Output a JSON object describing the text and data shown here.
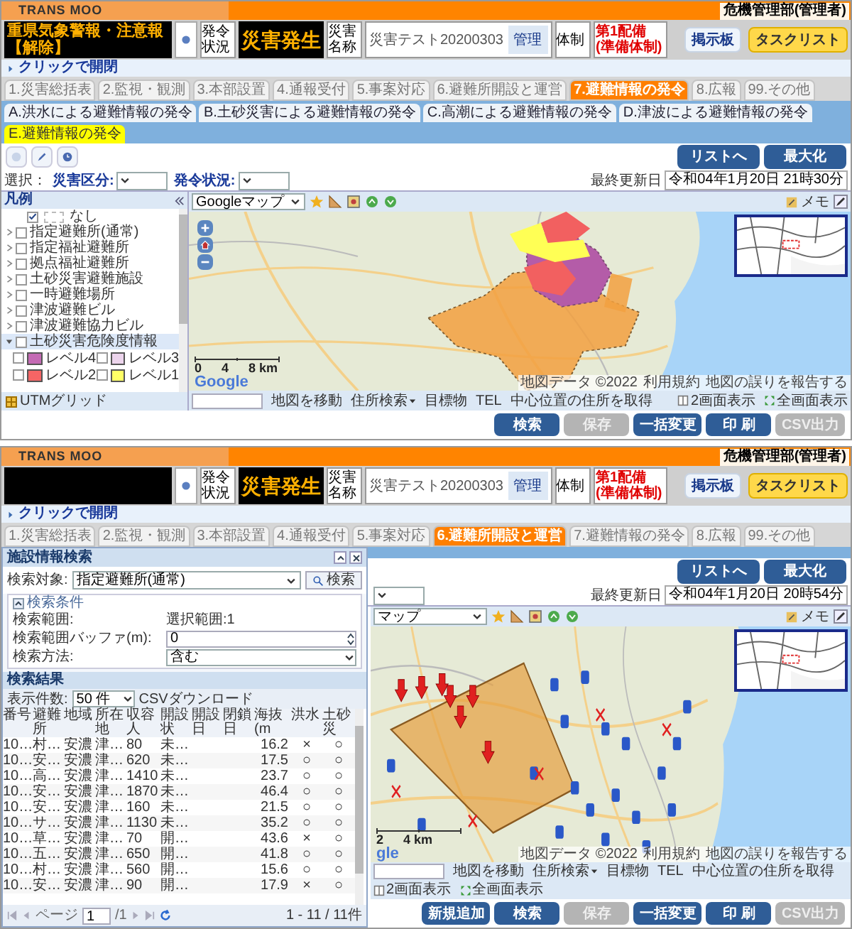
{
  "screens": [
    {
      "brand": "TRANS MOO",
      "user": "危機管理部(管理者)",
      "alert": {
        "title": "重県気象警報・注意報",
        "suffix": "【解除】"
      },
      "status_label": "発令状況",
      "status": "災害発生",
      "disaster_label": "災害名称",
      "disaster_name": "災害テスト20200303",
      "manage_button": "管理",
      "system_label": "体制",
      "system": "第1配備(準備体制)",
      "header_buttons": [
        "掲示板",
        "タスクリスト"
      ],
      "toggle": "クリックで開閉",
      "tabs": [
        {
          "label": "1.災害総括表",
          "selected": false
        },
        {
          "label": "2.監視・観測",
          "selected": false
        },
        {
          "label": "3.本部設置",
          "selected": false
        },
        {
          "label": "4.通報受付",
          "selected": false
        },
        {
          "label": "5.事案対応",
          "selected": false
        },
        {
          "label": "6.避難所開設と運営",
          "selected": false
        },
        {
          "label": "7.避難情報の発令",
          "selected": true
        },
        {
          "label": "8.広報",
          "selected": false
        },
        {
          "label": "99.その他",
          "selected": false
        }
      ],
      "subtabs": [
        {
          "label": "A.洪水による避難情報の発令",
          "selected": false
        },
        {
          "label": "B.土砂災害による避難情報の発令",
          "selected": false
        },
        {
          "label": "C.高潮による避難情報の発令",
          "selected": false
        },
        {
          "label": "D.津波による避難情報の発令",
          "selected": false
        },
        {
          "label": "E.避難情報の発令",
          "selected": true
        }
      ],
      "toolbar_buttons": [
        "リストへ",
        "最大化"
      ],
      "filter_label": "選択：",
      "filters": [
        {
          "label": "災害区分:",
          "kind": "dropdown"
        },
        {
          "label": "発令状況:",
          "kind": "dropdown"
        }
      ],
      "updated_label": "最終更新日",
      "updated": "令和04年1月20日 21時30分",
      "map_type": "Googleマップ",
      "memo": "メモ",
      "legend": {
        "title": "凡例",
        "footer": "UTMグリッド",
        "items": [
          {
            "kind": "none",
            "label": "なし",
            "checked": true,
            "selected": false
          },
          {
            "kind": "layer",
            "label": "指定避難所(通常)",
            "checked": false,
            "expanded": false,
            "selected": false
          },
          {
            "kind": "layer",
            "label": "指定福祉避難所",
            "checked": false,
            "expanded": false,
            "selected": false
          },
          {
            "kind": "layer",
            "label": "拠点福祉避難所",
            "checked": false,
            "expanded": false,
            "selected": false
          },
          {
            "kind": "layer",
            "label": "土砂災害避難施設",
            "checked": false,
            "expanded": false,
            "selected": false
          },
          {
            "kind": "layer",
            "label": "一時避難場所",
            "checked": false,
            "expanded": false,
            "selected": false
          },
          {
            "kind": "layer",
            "label": "津波避難ビル",
            "checked": false,
            "expanded": false,
            "selected": false
          },
          {
            "kind": "layer",
            "label": "津波避難協力ビル",
            "checked": false,
            "expanded": false,
            "selected": false
          },
          {
            "kind": "layer",
            "label": "土砂災害危険度情報",
            "checked": false,
            "expanded": true,
            "selected": true,
            "children": [
              {
                "label": "レベル4",
                "checked": false,
                "color": "#c46ab4"
              },
              {
                "label": "レベル3",
                "checked": false,
                "color": "#ecd4ec"
              },
              {
                "label": "レベル2",
                "checked": false,
                "color": "#f66565"
              },
              {
                "label": "レベル1",
                "checked": false,
                "color": "#ffff66"
              }
            ]
          }
        ]
      },
      "map": {
        "kind": "hazard",
        "logo": "Google",
        "scale": [
          "0",
          "4",
          "8 km"
        ],
        "attribution": [
          "地図データ ©2022",
          "利用規約",
          "地図の誤りを報告する"
        ]
      },
      "map_footer": [
        {
          "label": "地図を移動",
          "kind": "link"
        },
        {
          "label": "住所検索",
          "kind": "menu"
        },
        {
          "label": "目標物",
          "kind": "link"
        },
        {
          "label": "TEL",
          "kind": "link"
        },
        {
          "label": "中心位置の住所を取得",
          "kind": "link"
        }
      ],
      "view_buttons": [
        {
          "label": "2画面表示",
          "kind": "split"
        },
        {
          "label": "全画面表示",
          "kind": "full"
        }
      ],
      "action_buttons": [
        {
          "label": "検索",
          "disabled": false
        },
        {
          "label": "保存",
          "disabled": true
        },
        {
          "label": "一括変更",
          "disabled": false
        },
        {
          "label": "印 刷",
          "disabled": false
        },
        {
          "label": "CSV出力",
          "disabled": true
        }
      ]
    },
    {
      "brand": "TRANS MOO",
      "user": "危機管理部(管理者)",
      "status_label": "発令状況",
      "status": "災害発生",
      "disaster_label": "災害名称",
      "disaster_name": "災害テスト20200303",
      "manage_button": "管理",
      "system_label": "体制",
      "system": "第1配備(準備体制)",
      "header_buttons": [
        "掲示板",
        "タスクリスト"
      ],
      "toggle": "クリックで開閉",
      "tabs": [
        {
          "label": "1.災害総括表",
          "selected": false
        },
        {
          "label": "2.監視・観測",
          "selected": false
        },
        {
          "label": "3.本部設置",
          "selected": false
        },
        {
          "label": "4.通報受付",
          "selected": false
        },
        {
          "label": "5.事案対応",
          "selected": false
        },
        {
          "label": "6.避難所開設と運営",
          "selected": true
        },
        {
          "label": "7.避難情報の発令",
          "selected": false
        },
        {
          "label": "8.広報",
          "selected": false
        },
        {
          "label": "99.その他",
          "selected": false
        }
      ],
      "toolbar_buttons": [
        "リストへ",
        "最大化"
      ],
      "filters": [
        {
          "kind": "dropdown"
        }
      ],
      "updated_label": "最終更新日",
      "updated": "令和04年1月20日 20時54分",
      "map_type": "マップ",
      "memo": "メモ",
      "map": {
        "kind": "shelters",
        "logo": "gle",
        "scale": [
          "2",
          "4 km"
        ],
        "attribution": [
          "地図データ ©2022",
          "利用規約",
          "地図の誤りを報告する"
        ]
      },
      "map_footer": [
        {
          "label": "地図を移動",
          "kind": "link"
        },
        {
          "label": "住所検索",
          "kind": "menu"
        },
        {
          "label": "目標物",
          "kind": "link"
        },
        {
          "label": "TEL",
          "kind": "link"
        },
        {
          "label": "中心位置の住所を取得",
          "kind": "link"
        }
      ],
      "view_buttons": [
        {
          "label": "2画面表示",
          "kind": "split"
        },
        {
          "label": "全画面表示",
          "kind": "full"
        }
      ],
      "action_buttons": [
        {
          "label": "新規追加",
          "disabled": false
        },
        {
          "label": "検索",
          "disabled": false
        },
        {
          "label": "保存",
          "disabled": true
        },
        {
          "label": "一括変更",
          "disabled": false
        },
        {
          "label": "印 刷",
          "disabled": false
        },
        {
          "label": "CSV出力",
          "disabled": true
        }
      ],
      "search_panel": {
        "title": "施設情報検索",
        "target_label": "検索対象:",
        "target": "指定避難所(通常)",
        "search_button": "検索",
        "conditions_title": "検索条件",
        "conditions": [
          {
            "kind": "text",
            "label": "検索範囲:",
            "value": "選択範囲:1"
          },
          {
            "kind": "spinner",
            "label": "検索範囲バッファ(m):",
            "value": "0"
          },
          {
            "kind": "select",
            "label": "検索方法:",
            "value": "含む"
          }
        ],
        "results_title": "検索結果",
        "page_size_label": "表示件数:",
        "page_size": "50 件",
        "csv_link": "CSVダウンロード",
        "columns": [
          "番号",
          "避難所",
          "地域",
          "所在地",
          "収容人",
          "開設状",
          "開設日",
          "閉鎖日",
          "海抜(m",
          "洪水",
          "土砂災"
        ],
        "rows": [
          [
            "10…",
            "村…",
            "安濃",
            "津…",
            "80",
            "未…",
            "",
            "",
            "16.2",
            "×",
            "○"
          ],
          [
            "10…",
            "安…",
            "安濃",
            "津…",
            "620",
            "未…",
            "",
            "",
            "17.5",
            "○",
            "○"
          ],
          [
            "10…",
            "高…",
            "安濃",
            "津…",
            "1410",
            "未…",
            "",
            "",
            "23.7",
            "○",
            "○"
          ],
          [
            "10…",
            "安…",
            "安濃",
            "津…",
            "1870",
            "未…",
            "",
            "",
            "46.4",
            "○",
            "○"
          ],
          [
            "10…",
            "安…",
            "安濃",
            "津…",
            "160",
            "未…",
            "",
            "",
            "21.5",
            "○",
            "○"
          ],
          [
            "10…",
            "サ…",
            "安濃",
            "津…",
            "1130",
            "未…",
            "",
            "",
            "35.2",
            "○",
            "○"
          ],
          [
            "10…",
            "草…",
            "安濃",
            "津…",
            "70",
            "開…",
            "",
            "",
            "43.6",
            "×",
            "○"
          ],
          [
            "10…",
            "五…",
            "安濃",
            "津…",
            "650",
            "開…",
            "",
            "",
            "41.8",
            "○",
            "○"
          ],
          [
            "10…",
            "村…",
            "安濃",
            "津…",
            "560",
            "開…",
            "",
            "",
            "15.6",
            "○",
            "○"
          ],
          [
            "10…",
            "安…",
            "安濃",
            "津…",
            "90",
            "開…",
            "",
            "",
            "17.9",
            "×",
            "○"
          ]
        ],
        "page_label": "ページ",
        "page": "1",
        "page_total": "/1",
        "range": "1 - 11 / 11件"
      }
    }
  ]
}
